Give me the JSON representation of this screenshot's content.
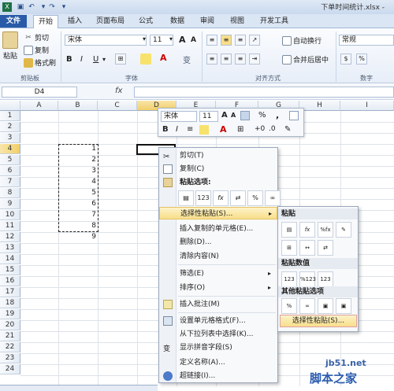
{
  "window": {
    "title": "下单时间统计.xlsx -"
  },
  "ribbon_tabs": [
    "文件",
    "开始",
    "插入",
    "页面布局",
    "公式",
    "数据",
    "审阅",
    "视图",
    "开发工具"
  ],
  "clipboard": {
    "paste": "粘贴",
    "cut": "剪切",
    "copy": "复制",
    "format_painter": "格式刷",
    "group": "剪贴板"
  },
  "font": {
    "name": "宋体",
    "size": "11",
    "bold": "B",
    "italic": "I",
    "underline": "U",
    "grow": "A",
    "shrink": "A",
    "phonetic": "变",
    "group": "字体"
  },
  "alignment": {
    "wrap": "自动换行",
    "merge": "合并后居中",
    "group": "对齐方式"
  },
  "number": {
    "format": "常规",
    "group": "数字"
  },
  "formula_bar": {
    "name_box": "D4",
    "fx": "fx",
    "value": ""
  },
  "columns": [
    "A",
    "B",
    "C",
    "D",
    "E",
    "F",
    "G",
    "H",
    "I"
  ],
  "rows": [
    "1",
    "2",
    "3",
    "4",
    "5",
    "6",
    "7",
    "8",
    "9",
    "10",
    "11",
    "12",
    "13",
    "14",
    "15",
    "16",
    "17",
    "18",
    "19",
    "20",
    "21",
    "22",
    "23",
    "24"
  ],
  "cells_b": [
    "1",
    "2",
    "3",
    "4",
    "5",
    "6",
    "7",
    "8",
    "9"
  ],
  "mini_toolbar": {
    "font": "宋体",
    "size": "11",
    "bold": "B",
    "italic": "I",
    "percent": "%",
    "comma": ",",
    "currency": "$"
  },
  "context_menu": {
    "cut": "剪切(T)",
    "copy": "复制(C)",
    "paste_options": "粘贴选项:",
    "paste_special": "选择性粘贴(S)...",
    "insert_copied": "插入复制的单元格(E)...",
    "delete": "删除(D)...",
    "clear": "清除内容(N)",
    "filter": "筛选(E)",
    "sort": "排序(O)",
    "insert_comment": "插入批注(M)",
    "format_cells": "设置单元格格式(F)...",
    "pick_list": "从下拉列表中选择(K)...",
    "phonetic": "显示拼音字段(S)",
    "define_name": "定义名称(A)...",
    "hyperlink": "超链接(I)..."
  },
  "submenu": {
    "paste": "粘贴",
    "paste_values": "粘贴数值",
    "other_paste": "其他粘贴选项",
    "paste_special": "选择性粘贴(S)..."
  },
  "watermark": {
    "line1": "jb51.net",
    "line2": "脚本之家"
  },
  "colors": {
    "file_tab": "#2a5ba8",
    "highlight": "#f8de8a",
    "accent": "#2b5cae"
  }
}
